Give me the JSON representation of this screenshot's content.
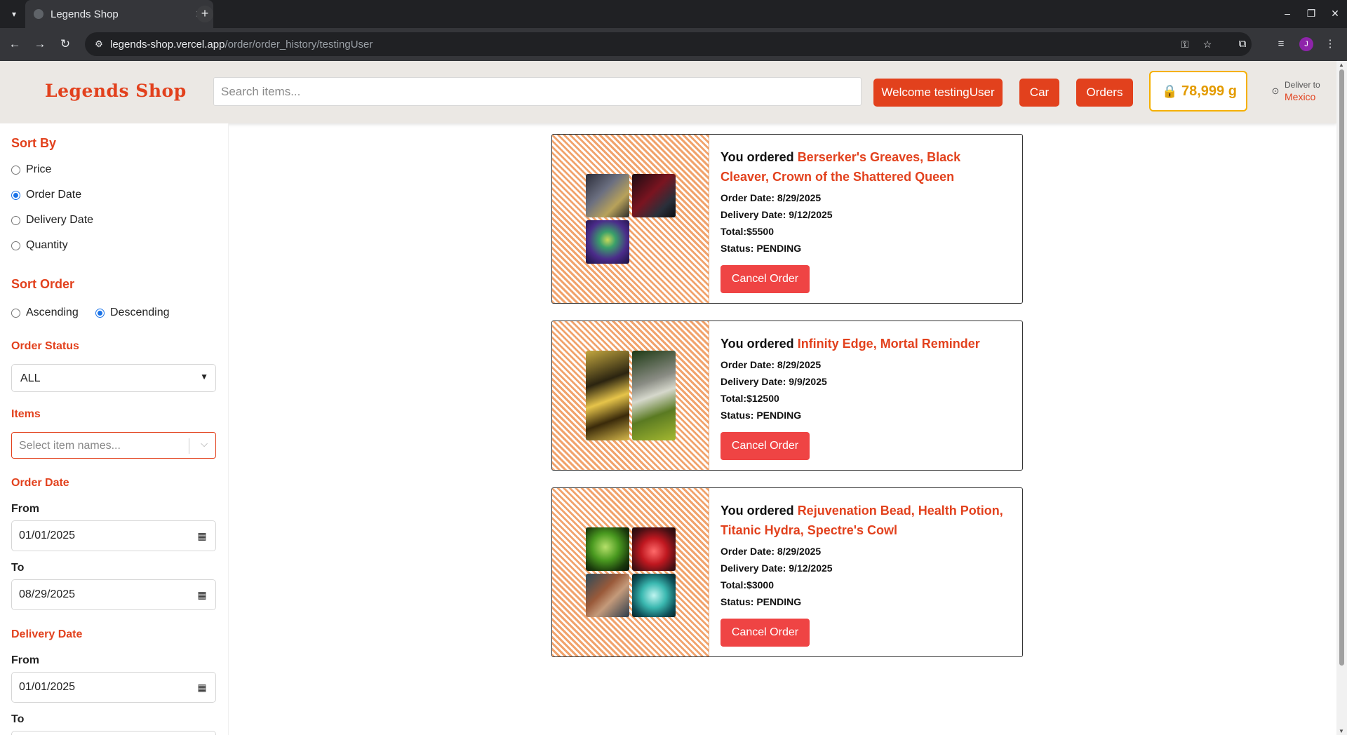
{
  "browser": {
    "tab_title": "Legends Shop",
    "url_domain": "legends-shop.vercel.app",
    "url_path": "/order/order_history/testingUser",
    "profile_initial": "J"
  },
  "header": {
    "logo": "Legends Shop",
    "search_placeholder": "Search items...",
    "welcome_label": "Welcome testingUser",
    "cart_label": "Car",
    "orders_label": "Orders",
    "gold_value": "78,999 g",
    "deliver_label": "Deliver to",
    "deliver_location": "Mexico"
  },
  "sidebar": {
    "sort_by_heading": "Sort By",
    "sort_by_options": [
      "Price",
      "Order Date",
      "Delivery Date",
      "Quantity"
    ],
    "sort_by_selected": "Order Date",
    "sort_order_heading": "Sort Order",
    "sort_order_options": [
      "Ascending",
      "Descending"
    ],
    "sort_order_selected": "Descending",
    "order_status_heading": "Order Status",
    "order_status_value": "ALL",
    "items_heading": "Items",
    "items_placeholder": "Select item names...",
    "order_date_heading": "Order Date",
    "order_date_from_label": "From",
    "order_date_from": "01/01/2025",
    "order_date_to_label": "To",
    "order_date_to": "08/29/2025",
    "delivery_date_heading": "Delivery Date",
    "delivery_date_from_label": "From",
    "delivery_date_from": "01/01/2025",
    "delivery_date_to_label": "To"
  },
  "orders": [
    {
      "prefix": "You ordered ",
      "items": "Berserker's Greaves, Black Cleaver, Crown of the Shattered Queen",
      "order_date": "Order Date: 8/29/2025",
      "delivery_date": "Delivery Date: 9/12/2025",
      "total": "Total:$5500",
      "status": "Status: PENDING",
      "cancel_label": "Cancel Order",
      "thumb_icons": [
        "greaves-icon",
        "cleaver-icon",
        "crown-icon"
      ]
    },
    {
      "prefix": "You ordered ",
      "items": "Infinity Edge, Mortal Reminder",
      "order_date": "Order Date: 8/29/2025",
      "delivery_date": "Delivery Date: 9/9/2025",
      "total": "Total:$12500",
      "status": "Status: PENDING",
      "cancel_label": "Cancel Order",
      "thumb_icons": [
        "infinity-edge-icon",
        "mortal-reminder-icon"
      ]
    },
    {
      "prefix": "You ordered ",
      "items": "Rejuvenation Bead, Health Potion, Titanic Hydra, Spectre's Cowl",
      "order_date": "Order Date: 8/29/2025",
      "delivery_date": "Delivery Date: 9/12/2025",
      "total": "Total:$3000",
      "status": "Status: PENDING",
      "cancel_label": "Cancel Order",
      "thumb_icons": [
        "rejuvenation-bead-icon",
        "health-potion-icon",
        "titanic-hydra-icon",
        "spectres-cowl-icon"
      ]
    }
  ],
  "colors": {
    "brand": "#e2411d",
    "cancel": "#ef4444",
    "gold": "#e39b00"
  }
}
